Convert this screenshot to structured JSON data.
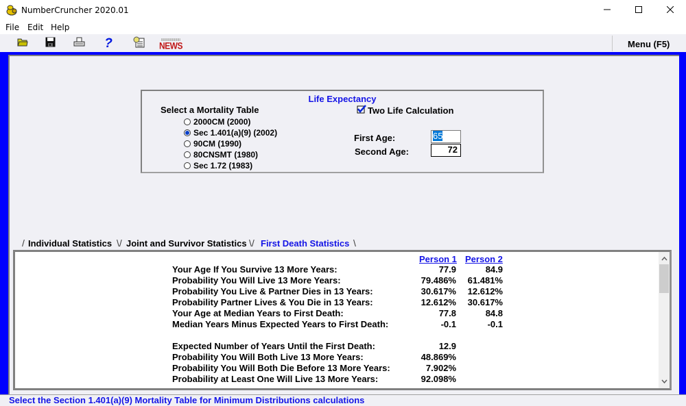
{
  "window": {
    "title": "NumberCruncher 2020.01",
    "app_icon": "money-bag-icon",
    "controls": {
      "minimize": "minimize-icon",
      "maximize": "maximize-icon",
      "close": "close-icon"
    }
  },
  "menubar": {
    "items": [
      "File",
      "Edit",
      "Help"
    ]
  },
  "toolbar": {
    "icons": [
      "open-folder-icon",
      "save-disk-icon",
      "print-icon",
      "help-question-icon",
      "notepad-icon",
      "news-icon"
    ],
    "news_label": "NEWS",
    "menu_button": "Menu (F5)"
  },
  "life_expectancy": {
    "title": "Life Expectancy",
    "mortality_label": "Select a Mortality Table",
    "tables": [
      {
        "label": "2000CM (2000)",
        "selected": false
      },
      {
        "label": "Sec 1.401(a)(9) (2002)",
        "selected": true
      },
      {
        "label": "90CM (1990)",
        "selected": false
      },
      {
        "label": "80CNSMT (1980)",
        "selected": false
      },
      {
        "label": "Sec 1.72 (1983)",
        "selected": false
      }
    ],
    "two_life_label": "Two Life Calculation",
    "two_life_checked": true,
    "first_age_label": "First Age:",
    "first_age_value": "65",
    "second_age_label": "Second Age:",
    "second_age_value": "72"
  },
  "tabs": [
    {
      "label": "Individual Statistics",
      "active": false
    },
    {
      "label": "Joint and Survivor Statistics",
      "active": false
    },
    {
      "label": "First Death Statistics",
      "active": true
    }
  ],
  "stats": {
    "col1": "Person 1",
    "col2": "Person 2",
    "rows": [
      {
        "label": "Your Age If You Survive 13 More Years:",
        "p1": "77.9",
        "p2": "84.9"
      },
      {
        "label": "Probability You Will Live 13 More Years:",
        "p1": "79.486%",
        "p2": "61.481%"
      },
      {
        "label": "Probability You Live & Partner Dies in 13 Years:",
        "p1": "30.617%",
        "p2": "12.612%"
      },
      {
        "label": "Probability Partner Lives & You Die in 13 Years:",
        "p1": "12.612%",
        "p2": "30.617%"
      },
      {
        "label": "Your Age at Median Years to First Death:",
        "p1": "77.8",
        "p2": "84.8"
      },
      {
        "label": "Median Years Minus Expected Years to First Death:",
        "p1": "-0.1",
        "p2": "-0.1"
      }
    ],
    "joint_rows": [
      {
        "label": "Expected Number of Years Until the First Death:",
        "value": "12.9"
      },
      {
        "label": "Probability You Will Both Live 13 More Years:",
        "value": "48.869%"
      },
      {
        "label": "Probability You Will Both Die Before 13 More Years:",
        "value": "7.902%"
      },
      {
        "label": "Probability at Least One Will Live 13 More Years:",
        "value": "92.098%"
      }
    ]
  },
  "status": "Select the Section 1.401(a)(9) Mortality Table for Minimum Distributions calculations",
  "colors": {
    "accent": "#1414e6",
    "frame": "#0000ff",
    "panel": "#f0f0f5"
  }
}
